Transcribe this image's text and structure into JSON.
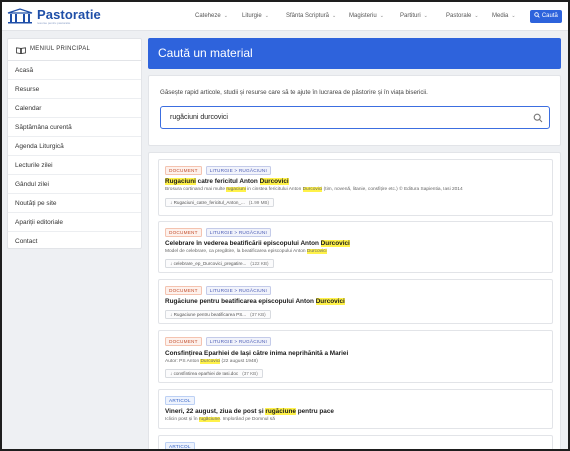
{
  "header": {
    "brand": "Pastoratie",
    "brand_tagline": "resurse pentru pastoratie",
    "nav": [
      "Cateheze",
      "Liturgie",
      "Sfânta Scriptură",
      "Magisteriu",
      "Partituri",
      "Pastorale",
      "Media"
    ],
    "search_button": "Caută"
  },
  "sidebar": {
    "title": "MENIUL PRINCIPAL",
    "items": [
      "Acasă",
      "Resurse",
      "Calendar",
      "Săptămâna curentă",
      "Agenda Liturgică",
      "Lecturile zilei",
      "Gândul zilei",
      "Noutăți pe site",
      "Apariții editoriale",
      "Contact"
    ]
  },
  "main": {
    "title": "Caută un material",
    "description": "Găsește rapid articole, studii și resurse care să te ajute în lucrarea de păstorire și în viața bisericii.",
    "search_value": "rugăciuni durcovici"
  },
  "results": [
    {
      "type": "DOCUMENT",
      "category": "LITURGIE > RUGĂCIUNI",
      "title": [
        {
          "t": "Rugaciuni",
          "h": true
        },
        {
          "t": " catre fericitul Anton ",
          "h": false
        },
        {
          "t": "Durcovici",
          "h": true
        }
      ],
      "excerpt": [
        {
          "t": "Brosura cortinand mai multe ",
          "h": false
        },
        {
          "t": "rugaciuni",
          "h": true
        },
        {
          "t": " in cinstea fericitului Anton ",
          "h": false
        },
        {
          "t": "Durcovici",
          "h": true
        },
        {
          "t": " (tim, novenă, litanie, consfițire etc.) © Editura Sapientia, Iasi 2014",
          "h": false
        }
      ],
      "file": "Rugaciuni_catre_fericitul_Anton_...",
      "size": "(1.99 MB)"
    },
    {
      "type": "DOCUMENT",
      "category": "LITURGIE > RUGĂCIUNI",
      "title": [
        {
          "t": "Celebrare în vederea beatificării episcopului Anton ",
          "h": false
        },
        {
          "t": "Durcovici",
          "h": true
        }
      ],
      "excerpt": [
        {
          "t": "Model de celebrare, ca pregătire, la beatificarea episcopului Anton ",
          "h": false
        },
        {
          "t": "Durcovici",
          "h": true
        }
      ],
      "file": "celebrare_ep_Durcovici_pregatire...",
      "size": "(122 KB)"
    },
    {
      "type": "DOCUMENT",
      "category": "LITURGIE > RUGĂCIUNI",
      "title": [
        {
          "t": "Rugăciune pentru beatificarea episcopului Anton ",
          "h": false
        },
        {
          "t": "Durcovici",
          "h": true
        }
      ],
      "excerpt": [],
      "file": "Rugaciune pentru beatificarea PS...",
      "size": "(37 KB)"
    },
    {
      "type": "DOCUMENT",
      "category": "LITURGIE > RUGĂCIUNI",
      "title": [
        {
          "t": "Consfințirea Eparhiei de Iași către inima neprihănită a Mariei",
          "h": false
        }
      ],
      "excerpt": [
        {
          "t": "Autor: PS Anton ",
          "h": false
        },
        {
          "t": "Durcovici",
          "h": true
        },
        {
          "t": " (22 august 1948)",
          "h": false
        }
      ],
      "file": "consfintirea eparhiei de Iasi.doc",
      "size": "(37 KB)"
    },
    {
      "type": "ARTICOL",
      "category": "",
      "title": [
        {
          "t": "Vineri, 22 august, ziua de post și ",
          "h": false
        },
        {
          "t": "rugăciune",
          "h": true
        },
        {
          "t": " pentru pace",
          "h": false
        }
      ],
      "excerpt": [
        {
          "t": "Iclicin post și în ",
          "h": false
        },
        {
          "t": "rugăciune",
          "h": true
        },
        {
          "t": ". Implorând pe Domnul să",
          "h": false
        }
      ],
      "file": "",
      "size": ""
    },
    {
      "type": "ARTICOL",
      "category": "",
      "title": [],
      "excerpt": [],
      "file": "",
      "size": ""
    }
  ],
  "colors": {
    "accent": "#2e63dc",
    "highlight": "#fff24a",
    "doc_tag": "#c4502f",
    "article_tag": "#2f5fc4"
  },
  "icons": {
    "logo": "church-columns-icon",
    "menu": "book-icon",
    "search": "magnifier-icon",
    "file": "download-icon"
  }
}
